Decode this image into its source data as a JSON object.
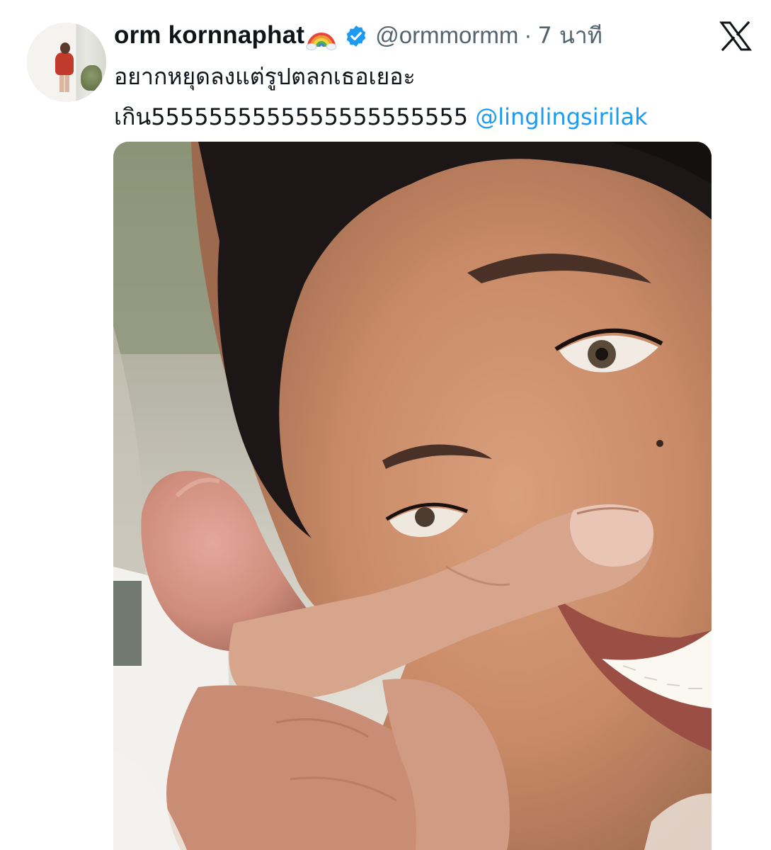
{
  "tweet": {
    "display_name": "orm kornnaphat",
    "handle": "@ormmormm",
    "separator": "·",
    "timestamp": "7 นาที",
    "text_line1": "อยากหยุดลงแต่รูปตลกเธอเยอะ",
    "text_line2_prefix": "เกิน5555555555555555555555 ",
    "mention": "@linglingsirilak"
  },
  "icons": {
    "name_emoji": "rainbow-icon",
    "verified": "verified-badge-icon",
    "platform": "x-logo-icon"
  },
  "colors": {
    "text": "#0f1419",
    "secondary": "#536471",
    "link": "#1d9bf0",
    "verified": "#1d9bf0"
  }
}
